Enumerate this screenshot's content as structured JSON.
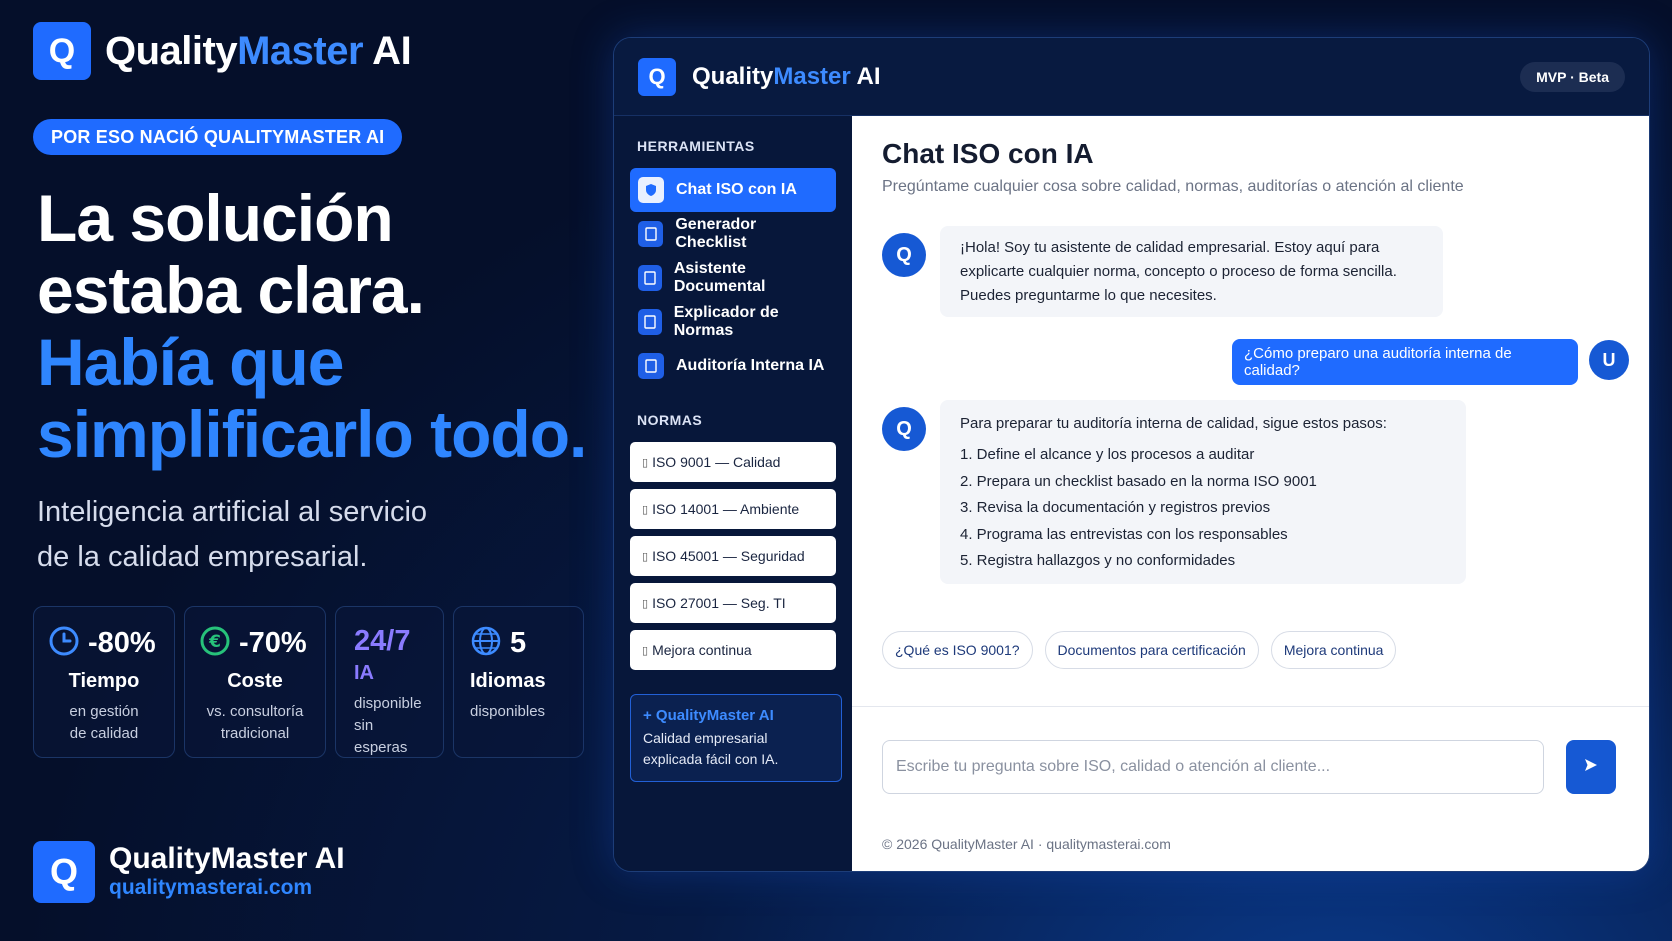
{
  "brand": {
    "name_part1": "Quality",
    "name_part2": "Master",
    "name_part3": " AI",
    "logo_letter": "Q",
    "accent_color": "#1f6bff"
  },
  "pill": "POR ESO NACIÓ QUALITYMASTER AI",
  "headline": {
    "line1": "La solución",
    "line2": "estaba clara.",
    "line3": "Había que",
    "line4": "simplificarlo todo."
  },
  "subline": {
    "line1": "Inteligencia artificial al servicio",
    "line2": "de la calidad empresarial."
  },
  "stats": [
    {
      "icon": "clock-icon",
      "value": "-80%",
      "label": "Tiempo",
      "desc1": "en gestión",
      "desc2": "de calidad"
    },
    {
      "icon": "euro-icon",
      "value": "-70%",
      "label": "Coste",
      "desc1": "vs. consultoría",
      "desc2": "tradicional"
    },
    {
      "icon": "",
      "value": "24/7",
      "label": "IA",
      "desc1": "disponible",
      "desc2": "sin esperas"
    },
    {
      "icon": "globe-icon",
      "value": "5",
      "label": "Idiomas",
      "desc1": "disponibles",
      "desc2": ""
    }
  ],
  "footer_brand": {
    "name": "QualityMaster AI",
    "url": "qualitymasterai.com"
  },
  "app": {
    "title_part1": "Quality",
    "title_part2": "Master",
    "title_part3": " AI",
    "badge": "MVP · Beta",
    "sidebar": {
      "tools_heading": "HERRAMIENTAS",
      "tools": [
        {
          "label": "Chat ISO con IA",
          "active": true
        },
        {
          "label": "Generador Checklist"
        },
        {
          "label": "Asistente Documental"
        },
        {
          "label": "Explicador de Normas"
        },
        {
          "label": "Auditoría Interna IA"
        }
      ],
      "norms_heading": "NORMAS",
      "norms": [
        "ISO 9001 — Calidad",
        "ISO 14001 — Ambiente",
        "ISO 45001 — Seguridad",
        "ISO 27001 — Seg. TI",
        "Mejora continua"
      ],
      "promo_title": "+ QualityMaster AI",
      "promo_line1": "Calidad empresarial",
      "promo_line2": "explicada fácil con IA."
    },
    "main": {
      "title": "Chat ISO con IA",
      "subtitle": "Pregúntame cualquier cosa sobre calidad, normas, auditorías o atención al cliente",
      "bot_avatar": "Q",
      "user_avatar": "U",
      "bot_msg1": {
        "line1": "¡Hola! Soy tu asistente de calidad empresarial. Estoy aquí para",
        "line2": "explicarte cualquier norma, concepto o proceso de forma sencilla.",
        "line3": "Puedes preguntarme lo que necesites."
      },
      "user_msg": "¿Cómo preparo una auditoría interna de calidad?",
      "bot_msg2": {
        "intro": "Para preparar tu auditoría interna de calidad, sigue estos pasos:",
        "steps": [
          "1. Define el alcance y los procesos a auditar",
          "2. Prepara un checklist basado en la norma ISO 9001",
          "3. Revisa la documentación y registros previos",
          "4. Programa las entrevistas con los responsables",
          "5. Registra hallazgos y no conformidades"
        ]
      },
      "chips": [
        "¿Qué es ISO 9001?",
        "Documentos para certificación",
        "Mejora continua"
      ],
      "input_placeholder": "Escribe tu pregunta sobre ISO, calidad o atención al cliente...",
      "footer": "© 2026 QualityMaster AI · qualitymasterai.com"
    }
  }
}
